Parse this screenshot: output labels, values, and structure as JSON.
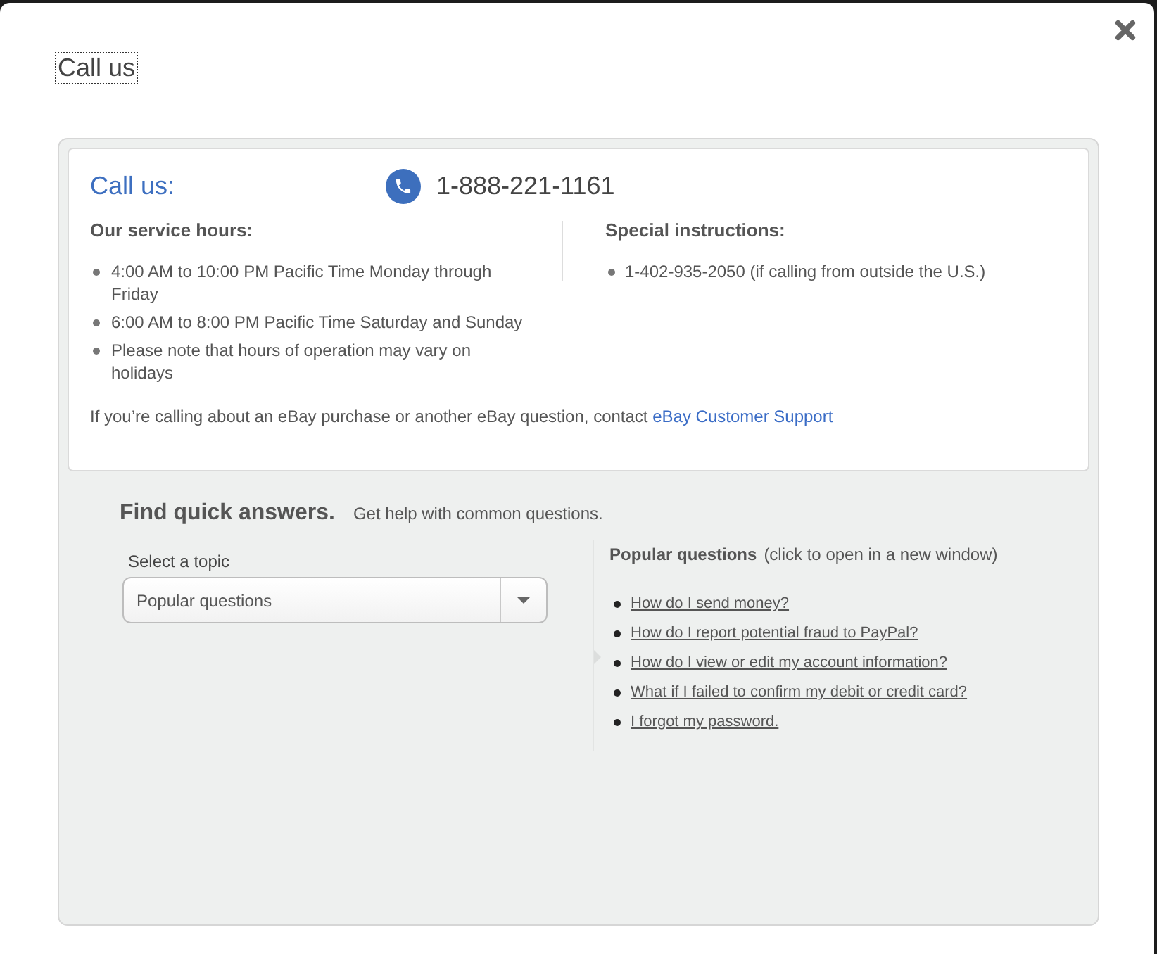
{
  "dialog": {
    "title": "Call us",
    "title_focused": true
  },
  "contact": {
    "heading": "Call us:",
    "phone": "1-888-221-1161",
    "service_hours": {
      "heading": "Our service hours:",
      "items": [
        "4:00 AM to 10:00 PM Pacific Time Monday through Friday",
        "6:00 AM to 8:00 PM Pacific Time Saturday and Sunday",
        "Please note that hours of operation may vary on holidays"
      ]
    },
    "special_instructions": {
      "heading": "Special instructions:",
      "items": [
        "1-402-935-2050 (if calling from outside the U.S.)"
      ]
    },
    "note": "If you’re calling about an eBay purchase or another eBay question, contact",
    "note_link": "eBay Customer Support"
  },
  "quick_answers": {
    "heading": "Find quick answers.",
    "subheading": "Get help with common questions.",
    "topic": {
      "label": "Select a topic",
      "value": "Popular questions"
    },
    "popular": {
      "heading": "Popular questions",
      "hint": "(click to open in a new window)",
      "questions": [
        "How do I send money?",
        "How do I report potential fraud to PayPal?",
        "How do I view or edit my account information?",
        "What if I failed to confirm my debit or credit card?",
        "I forgot my password."
      ]
    }
  }
}
